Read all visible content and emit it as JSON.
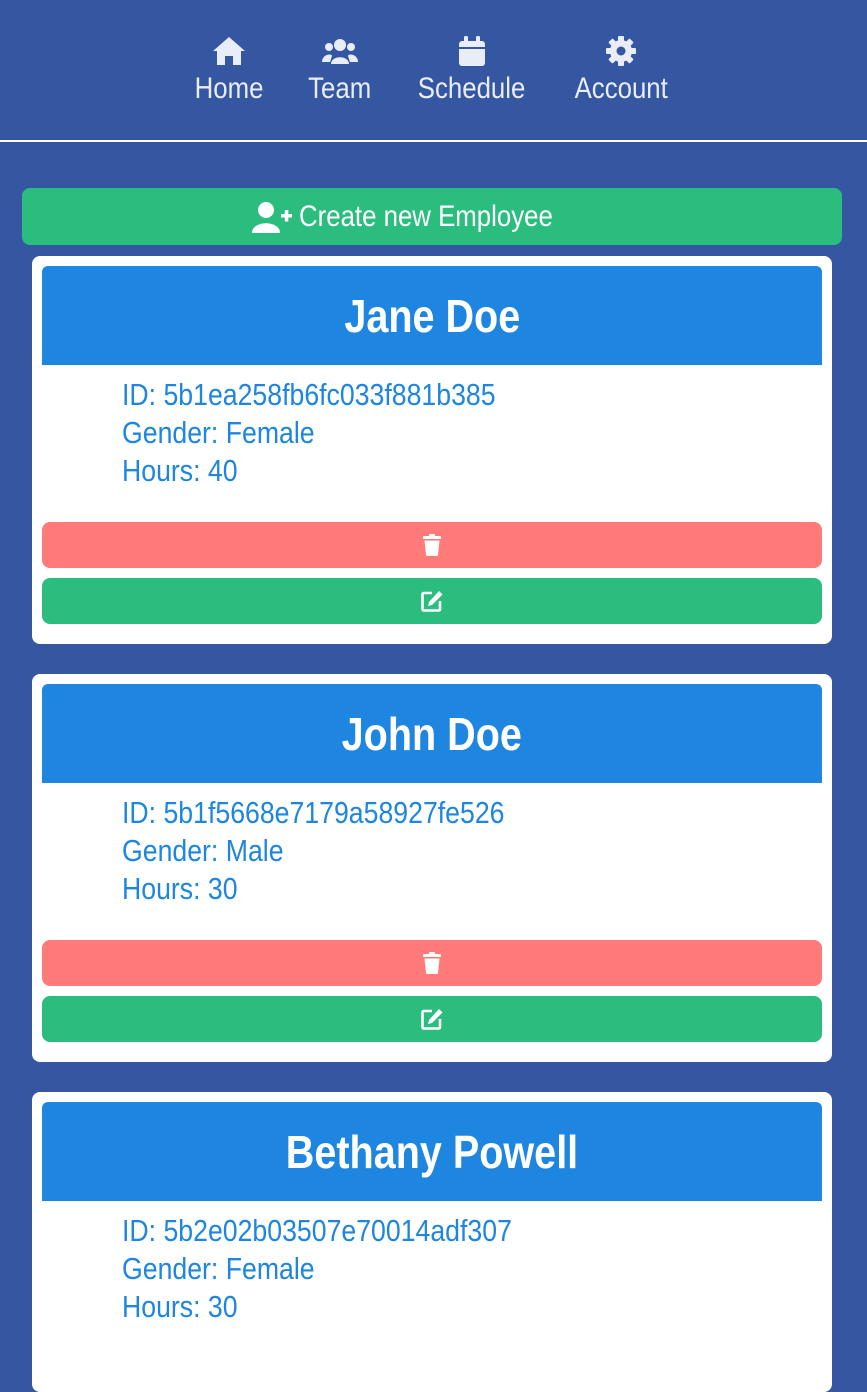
{
  "nav": {
    "items": [
      {
        "label": "Home",
        "icon": "home-icon"
      },
      {
        "label": "Team",
        "icon": "users-icon"
      },
      {
        "label": "Schedule",
        "icon": "calendar-icon"
      },
      {
        "label": "Account",
        "icon": "gear-icon"
      }
    ]
  },
  "create_button": {
    "label": "Create new Employee",
    "icon": "user-plus-icon"
  },
  "employees": [
    {
      "name": "Jane Doe",
      "id": "ID: 5b1ea258fb6fc033f881b385",
      "gender": "Gender: Female",
      "hours": "Hours: 40"
    },
    {
      "name": "John Doe",
      "id": "ID: 5b1f5668e7179a58927fe526",
      "gender": "Gender: Male",
      "hours": "Hours: 30"
    },
    {
      "name": "Bethany Powell",
      "id": "ID: 5b2e02b03507e70014adf307",
      "gender": "Gender: Female",
      "hours": "Hours: 30"
    }
  ],
  "colors": {
    "background": "#3556a0",
    "card_header": "#1e86e0",
    "delete": "#ff7a78",
    "edit": "#2bbd7e",
    "create": "#2bbd7e"
  },
  "card_icons": {
    "delete": "trash-icon",
    "edit": "edit-icon"
  }
}
